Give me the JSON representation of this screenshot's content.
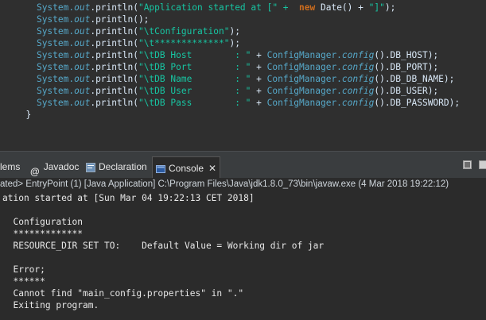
{
  "editor": {
    "lines": [
      {
        "sys": "System.",
        "out": "out",
        "pre": ".println(",
        "str": "\"Application started at [\" + ",
        "kw": "new",
        "mid": " Date() + ",
        "str2": "\"]\"",
        "end": ");"
      },
      {
        "sys": "System.",
        "out": "out",
        "rest": ".println();"
      },
      {
        "sys": "System.",
        "out": "out",
        "pre": ".println(",
        "str": "\"\\tConfiguration\"",
        "end": ");"
      },
      {
        "sys": "System.",
        "out": "out",
        "pre": ".println(",
        "str": "\"\\t*************\"",
        "end": ");"
      },
      {
        "sys": "System.",
        "out": "out",
        "pre": ".println(",
        "str": "\"\\tDB Host        : \"",
        "plus": " + ",
        "cm": "ConfigManager.",
        "cfg": "config",
        "tail": "().DB_HOST);"
      },
      {
        "sys": "System.",
        "out": "out",
        "pre": ".println(",
        "str": "\"\\tDB Port        : \"",
        "plus": " + ",
        "cm": "ConfigManager.",
        "cfg": "config",
        "tail": "().DB_PORT);"
      },
      {
        "sys": "System.",
        "out": "out",
        "pre": ".println(",
        "str": "\"\\tDB Name        : \"",
        "plus": " + ",
        "cm": "ConfigManager.",
        "cfg": "config",
        "tail": "().DB_DB_NAME);"
      },
      {
        "sys": "System.",
        "out": "out",
        "pre": ".println(",
        "str": "\"\\tDB User        : \"",
        "plus": " + ",
        "cm": "ConfigManager.",
        "cfg": "config",
        "tail": "().DB_USER);"
      },
      {
        "sys": "System.",
        "out": "out",
        "pre": ".println(",
        "str": "\"\\tDB Pass        : \"",
        "plus": " + ",
        "cm": "ConfigManager.",
        "cfg": "config",
        "tail": "().DB_PASSWORD);"
      }
    ],
    "closing_brace": "}"
  },
  "tabs": {
    "problems": "lems",
    "javadoc": "Javadoc",
    "declaration": "Declaration",
    "console": "Console",
    "close": "✕"
  },
  "status": "ated> EntryPoint (1) [Java Application] C:\\Program Files\\Java\\jdk1.8.0_73\\bin\\javaw.exe (4 Mar 2018 19:22:12)",
  "console": {
    "lines": [
      "ation started at [Sun Mar 04 19:22:13 CET 2018]",
      "",
      "  Configuration",
      "  *************",
      "  RESOURCE_DIR SET TO:    Default Value = Working dir of jar",
      "",
      "  Error;",
      "  ******",
      "  Cannot find \"main_config.properties\" in \".\"",
      "  Exiting program."
    ]
  },
  "icons": [
    "javadoc-at-icon",
    "declaration-icon",
    "console-icon",
    "maximize-icon",
    "minimize-icon"
  ]
}
